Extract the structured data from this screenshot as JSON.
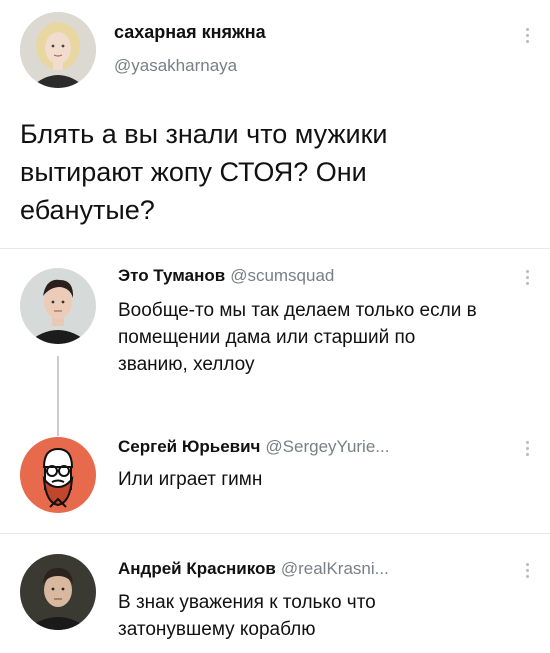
{
  "main_tweet": {
    "author_name": "сахарная княжна",
    "author_handle": "@yasakharnaya",
    "text": "Блять а вы знали что мужики\nвытирают жопу СТОЯ? Они\nебанутые?"
  },
  "replies": [
    {
      "author_name": "Это Туманов",
      "author_handle": "@scumsquad",
      "text": "Вообще-то мы так делаем только если в\nпомещении дама или старший по\nзванию, хеллоу"
    },
    {
      "author_name": "Сергей Юрьевич",
      "author_handle": "@SergeyYurie...",
      "text": "Или играет гимн"
    },
    {
      "author_name": "Андрей Красников",
      "author_handle": "@realKrasni...",
      "text": "В знак уважения к только что\nзатонувшему кораблю"
    }
  ],
  "icons": {
    "more": "more-vertical-icon"
  },
  "colors": {
    "handle": "#7a7f85",
    "thread_line": "#c9cdd1",
    "divider": "#e6e8ea",
    "avatar_accent": "#e06a4e"
  }
}
